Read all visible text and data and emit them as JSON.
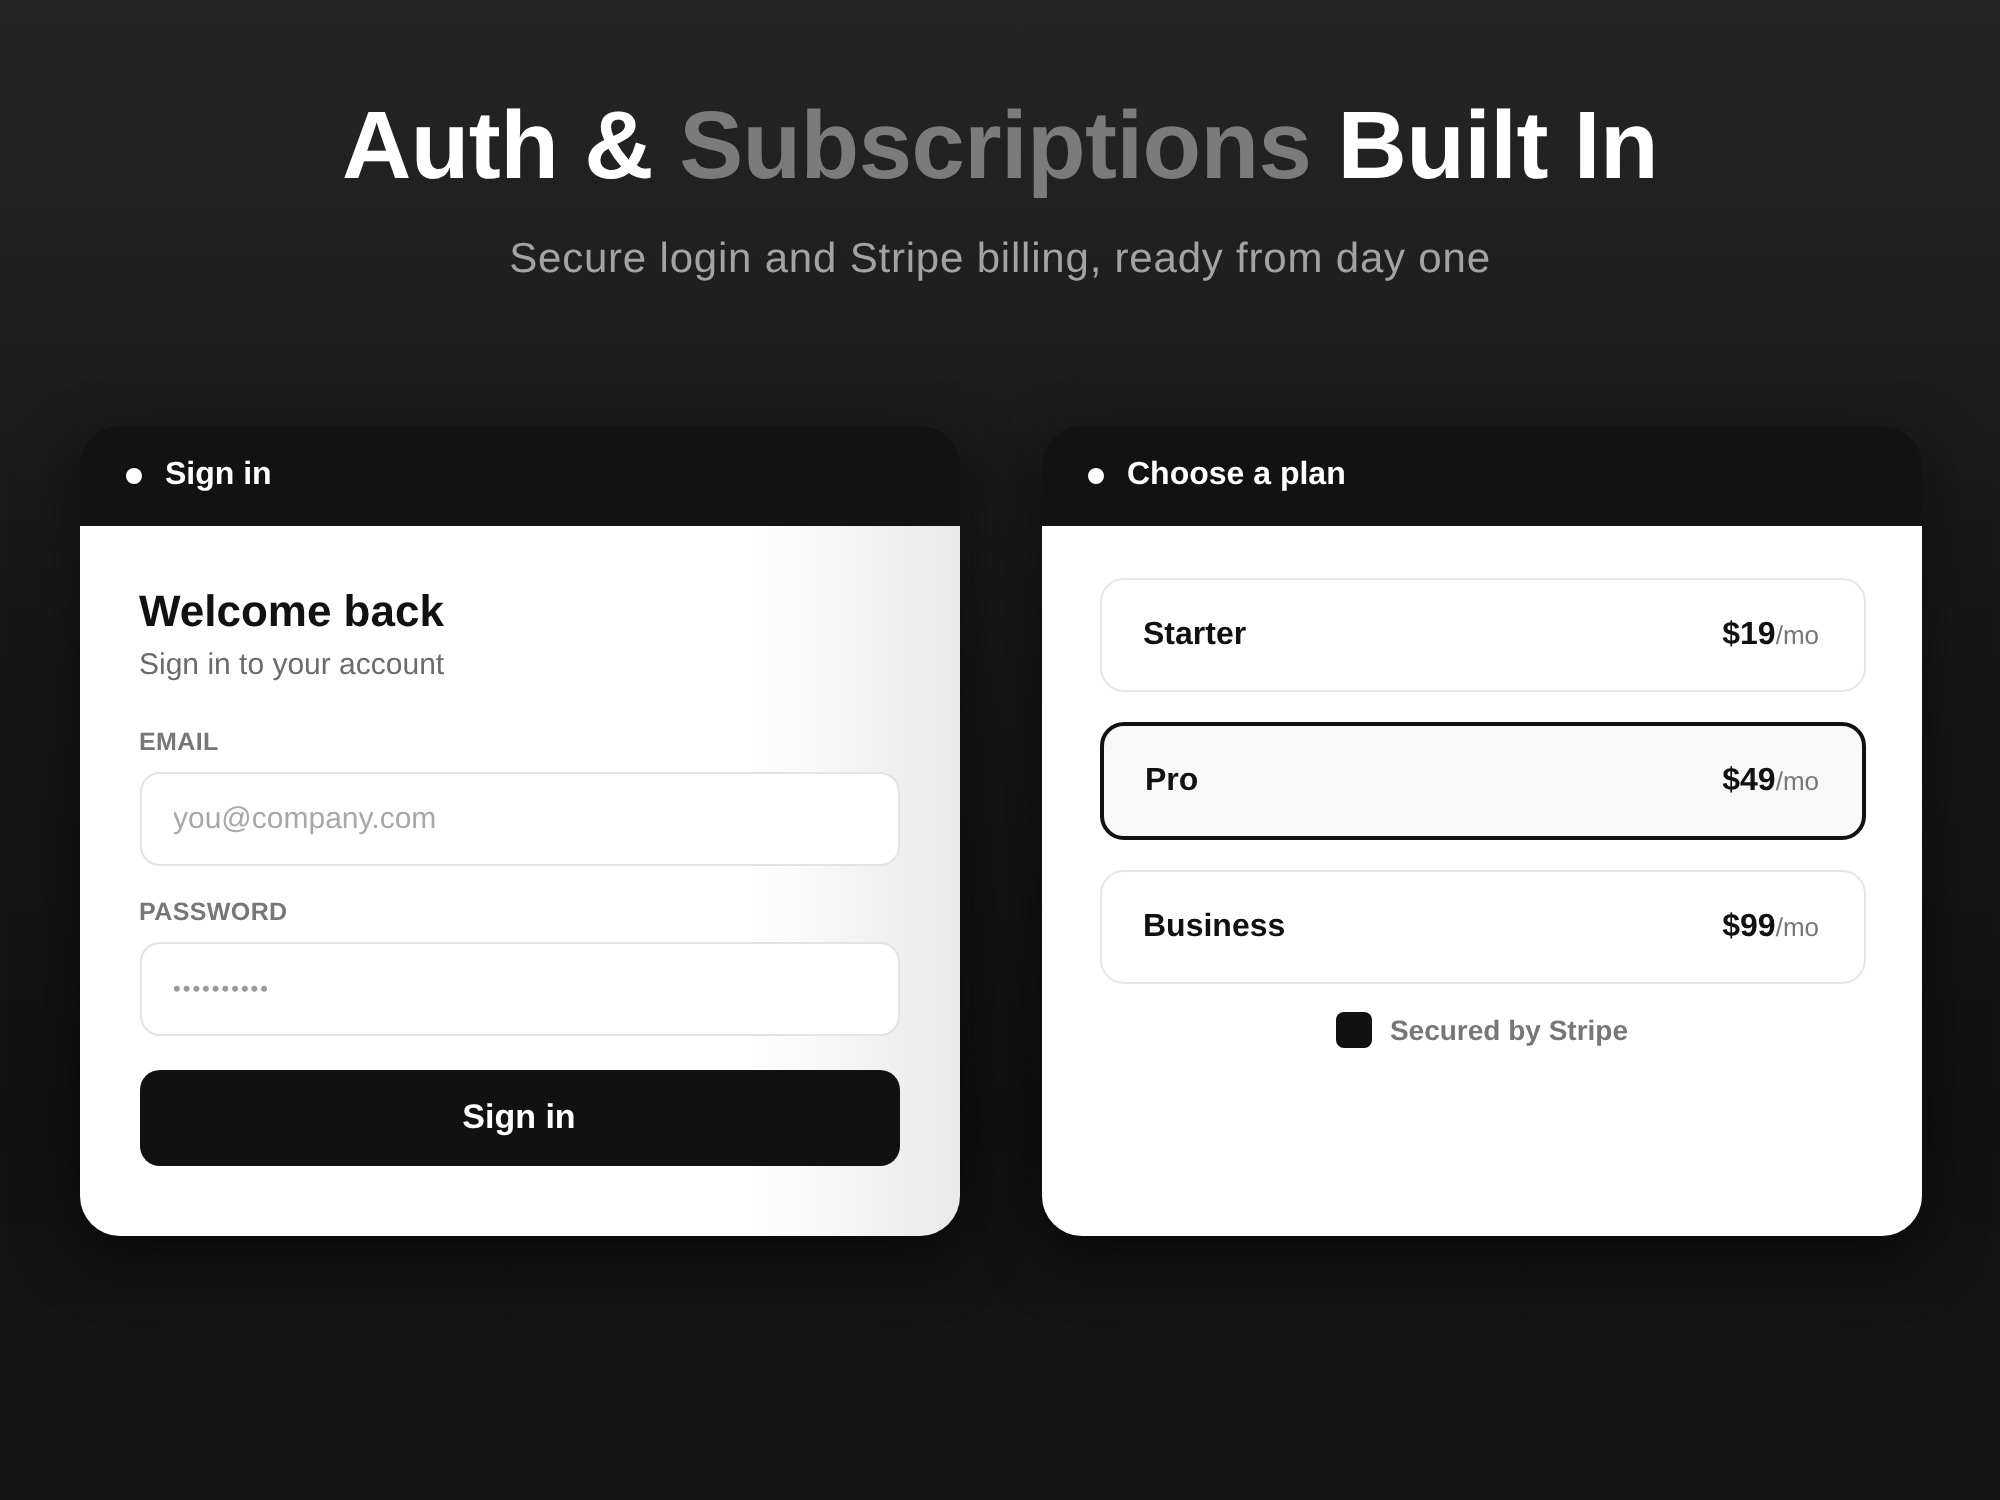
{
  "header": {
    "title_parts": [
      {
        "text": "Auth &",
        "accent": false
      },
      {
        "text": "Subscriptions",
        "accent": true
      },
      {
        "text": "Built In",
        "accent": false
      }
    ],
    "subtitle": "Secure login and Stripe billing, ready from day one"
  },
  "sign_in_card": {
    "header": "Sign in",
    "heading": "Welcome back",
    "subheading": "Sign in to your account",
    "fields": [
      {
        "kind": "email",
        "label": "EMAIL",
        "placeholder": "you@company.com"
      },
      {
        "kind": "password",
        "label": "PASSWORD",
        "placeholder": "••••••••••"
      }
    ],
    "button": "Sign in"
  },
  "plan_card": {
    "header": "Choose a plan",
    "plans": [
      {
        "name": "Starter",
        "price": "$19",
        "period": "/mo",
        "selected": false
      },
      {
        "name": "Pro",
        "price": "$49",
        "period": "/mo",
        "selected": true
      },
      {
        "name": "Business",
        "price": "$99",
        "period": "/mo",
        "selected": false
      }
    ],
    "footer": "Secured by Stripe"
  }
}
